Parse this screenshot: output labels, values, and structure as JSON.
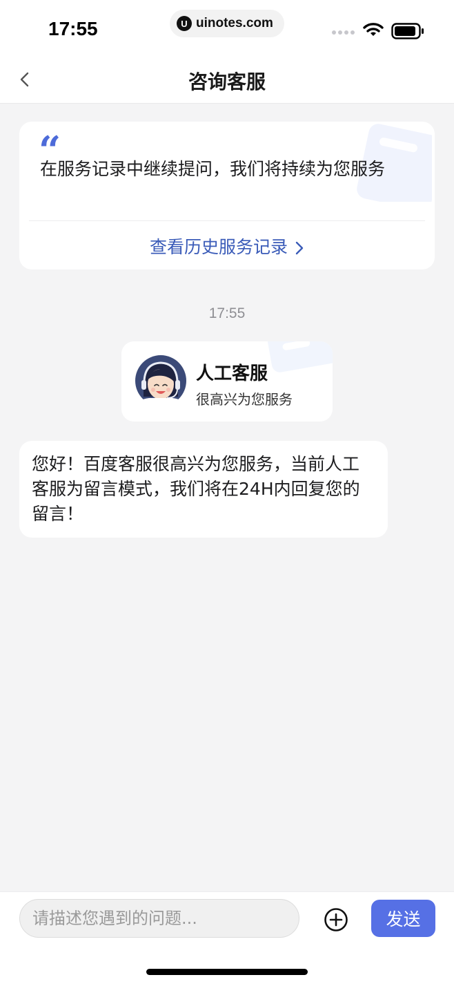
{
  "status_bar": {
    "time": "17:55",
    "watermark_logo": "U",
    "watermark_text": "uinotes.com",
    "icons": [
      "signal-dots-icon",
      "wifi-icon",
      "battery-icon"
    ]
  },
  "nav": {
    "title": "咨询客服",
    "back_icon": "chevron-left-icon"
  },
  "history_card": {
    "quote_mark": "“",
    "text": "在服务记录中继续提问，我们将持续为您服务",
    "link_label": "查看历史服务记录"
  },
  "timestamp": "17:55",
  "agent_card": {
    "name": "人工客服",
    "subtitle": "很高兴为您服务"
  },
  "message": {
    "text": "您好！百度客服很高兴为您服务，当前人工客服为留言模式，我们将在24H内回复您的留言！"
  },
  "input_bar": {
    "placeholder": "请描述您遇到的问题...",
    "value": "",
    "send_label": "发送"
  },
  "colors": {
    "accent": "#5670e5",
    "link": "#3a5bb8",
    "quote": "#4d6bd9",
    "background": "#f4f4f5"
  }
}
